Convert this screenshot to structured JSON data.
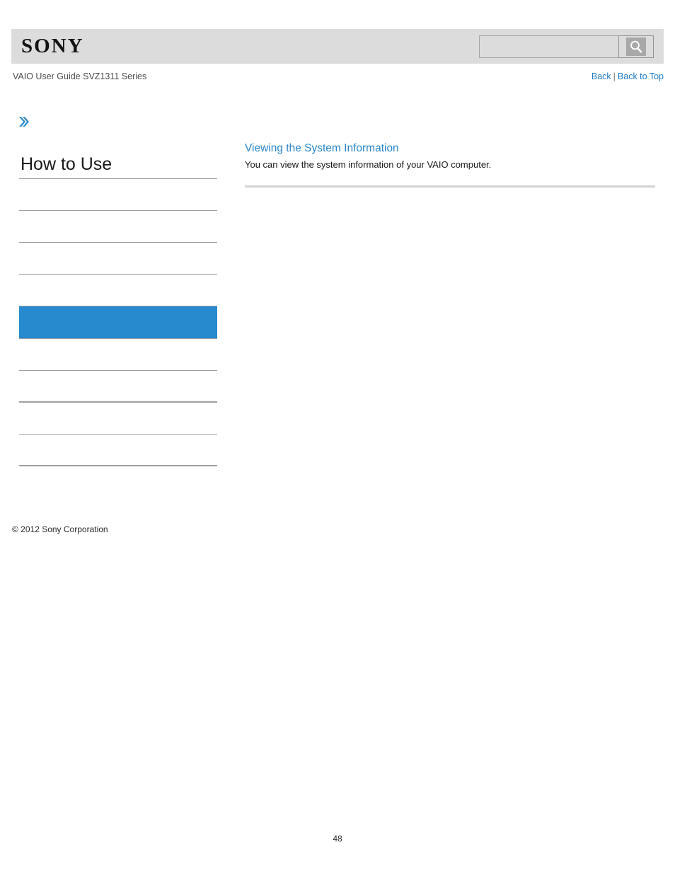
{
  "header": {
    "logo_text": "SONY",
    "search": {
      "value": "",
      "placeholder": "",
      "button_icon": "search-icon"
    }
  },
  "subheader": {
    "guide_title": "VAIO User Guide SVZ1311 Series",
    "back_label": "Back",
    "separator": "|",
    "back_to_top_label": "Back to Top"
  },
  "breadcrumb": {
    "icon": "double-chevron-right-icon"
  },
  "sidebar": {
    "title": "How to Use",
    "items": [
      {
        "label": "",
        "active": false,
        "thick": false
      },
      {
        "label": "",
        "active": false,
        "thick": false
      },
      {
        "label": "",
        "active": false,
        "thick": false
      },
      {
        "label": "",
        "active": false,
        "thick": false
      },
      {
        "label": "",
        "active": true,
        "thick": false
      },
      {
        "label": "",
        "active": false,
        "thick": false
      },
      {
        "label": "",
        "active": false,
        "thick": true
      },
      {
        "label": "",
        "active": false,
        "thick": false
      },
      {
        "label": "",
        "active": false,
        "thick": true
      }
    ],
    "copyright": "© 2012 Sony Corporation"
  },
  "content": {
    "heading": "Viewing the System Information",
    "body": "You can view the system information of your VAIO computer."
  },
  "footer": {
    "page_number": "48"
  },
  "colors": {
    "accent_blue": "#2789ce",
    "link_blue": "#1e7bc8",
    "heading_blue": "#2a86c8",
    "header_gray": "#dcdcdc",
    "rule_gray": "#9f9f9f"
  }
}
